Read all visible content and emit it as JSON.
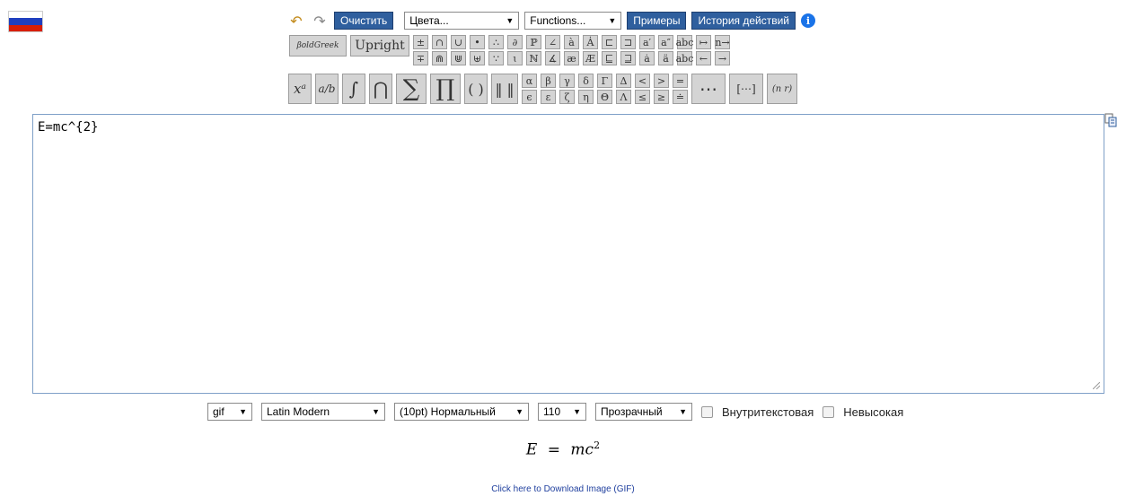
{
  "toolbar": {
    "clear_label": "Очистить",
    "colors_select": "Цвета...",
    "functions_select": "Functions...",
    "examples_label": "Примеры",
    "history_label": "История действий",
    "info_glyph": "i"
  },
  "symbols": {
    "boldgreek": "βoldGreek",
    "upright": "Upright",
    "row1": [
      "±",
      "∩",
      "∪",
      "•",
      "∴",
      "∂",
      "ℙ",
      "∠",
      "à",
      "Ȧ",
      "⊏",
      "⊐",
      "a′",
      "a″",
      "abc",
      "↦",
      "n→"
    ],
    "row2": [
      "∓",
      "⋒",
      "⋓",
      "⊎",
      "∵",
      "ɩ",
      "ℕ",
      "∡",
      "æ",
      "Æ",
      "⊑",
      "⊒",
      "ȧ",
      "ä",
      "abc",
      "←",
      "→"
    ],
    "big_power": "xᵃ",
    "big_frac": "a/b",
    "big_integral": "∫",
    "big_cap": "⋂",
    "big_sum": "∑",
    "big_prod": "∏",
    "big_paren": "( )",
    "big_norm": "‖ ‖",
    "greek_row1": [
      "α",
      "β",
      "γ",
      "δ",
      "Γ",
      "Δ",
      "<",
      ">",
      "="
    ],
    "greek_row2": [
      "ϵ",
      "ε",
      "ζ",
      "η",
      "Θ",
      "Λ",
      "≤",
      "≥",
      "≐"
    ],
    "dots": "⋯",
    "matrix": "[⋯]",
    "binom": "(n r)"
  },
  "editor": {
    "content": "E=mc^{2}"
  },
  "options": {
    "format": "gif",
    "font": "Latin Modern",
    "size": "(10pt) Нормальный",
    "dpi": "110",
    "background": "Прозрачный",
    "inline_label": "Внутритекстовая",
    "compressed_label": "Невысокая"
  },
  "preview": {
    "formula_lhs": "E",
    "formula_eq": "=",
    "formula_rhs": "mc",
    "formula_exp": "2"
  },
  "download_link": "Click here to Download Image (GIF)",
  "colors": {
    "accent": "#2f5f9e",
    "flag_white": "#ffffff",
    "flag_blue": "#1f3fbf",
    "flag_red": "#d81e05"
  }
}
